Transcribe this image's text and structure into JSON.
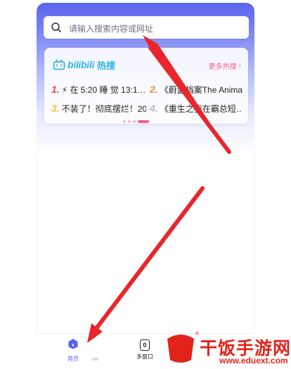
{
  "search": {
    "placeholder": "请输入搜索内容或网址"
  },
  "hot": {
    "brand": "bilibili",
    "brand_suffix": "热搜",
    "more_label": "更多热搜",
    "items": [
      {
        "rank": "1.",
        "title": "⚡ 在 5:20 睡 觉 13:1…",
        "color": "#f04a3a"
      },
      {
        "rank": "2.",
        "title": "《蔚蓝档案The Anima…",
        "color": "#f08c2f"
      },
      {
        "rank": "3.",
        "title": "不装了！彻底摆烂！20…",
        "color": "#f5c43a"
      },
      {
        "rank": "4.",
        "title": "《重生之我在霸总短…",
        "color": "#b8bcc6"
      }
    ]
  },
  "tabbar": {
    "home_label": "首页",
    "windows_label": "多窗口",
    "windows_count": "0"
  },
  "watermark": {
    "brand": "干饭手游网",
    "url": "www.eduext.com",
    "logo_char": "饭"
  },
  "colors": {
    "accent": "#5a63ef",
    "bilibili_blue": "#2fb5e8",
    "pink": "#f25d8e",
    "arrow_red": "#e8262c"
  }
}
